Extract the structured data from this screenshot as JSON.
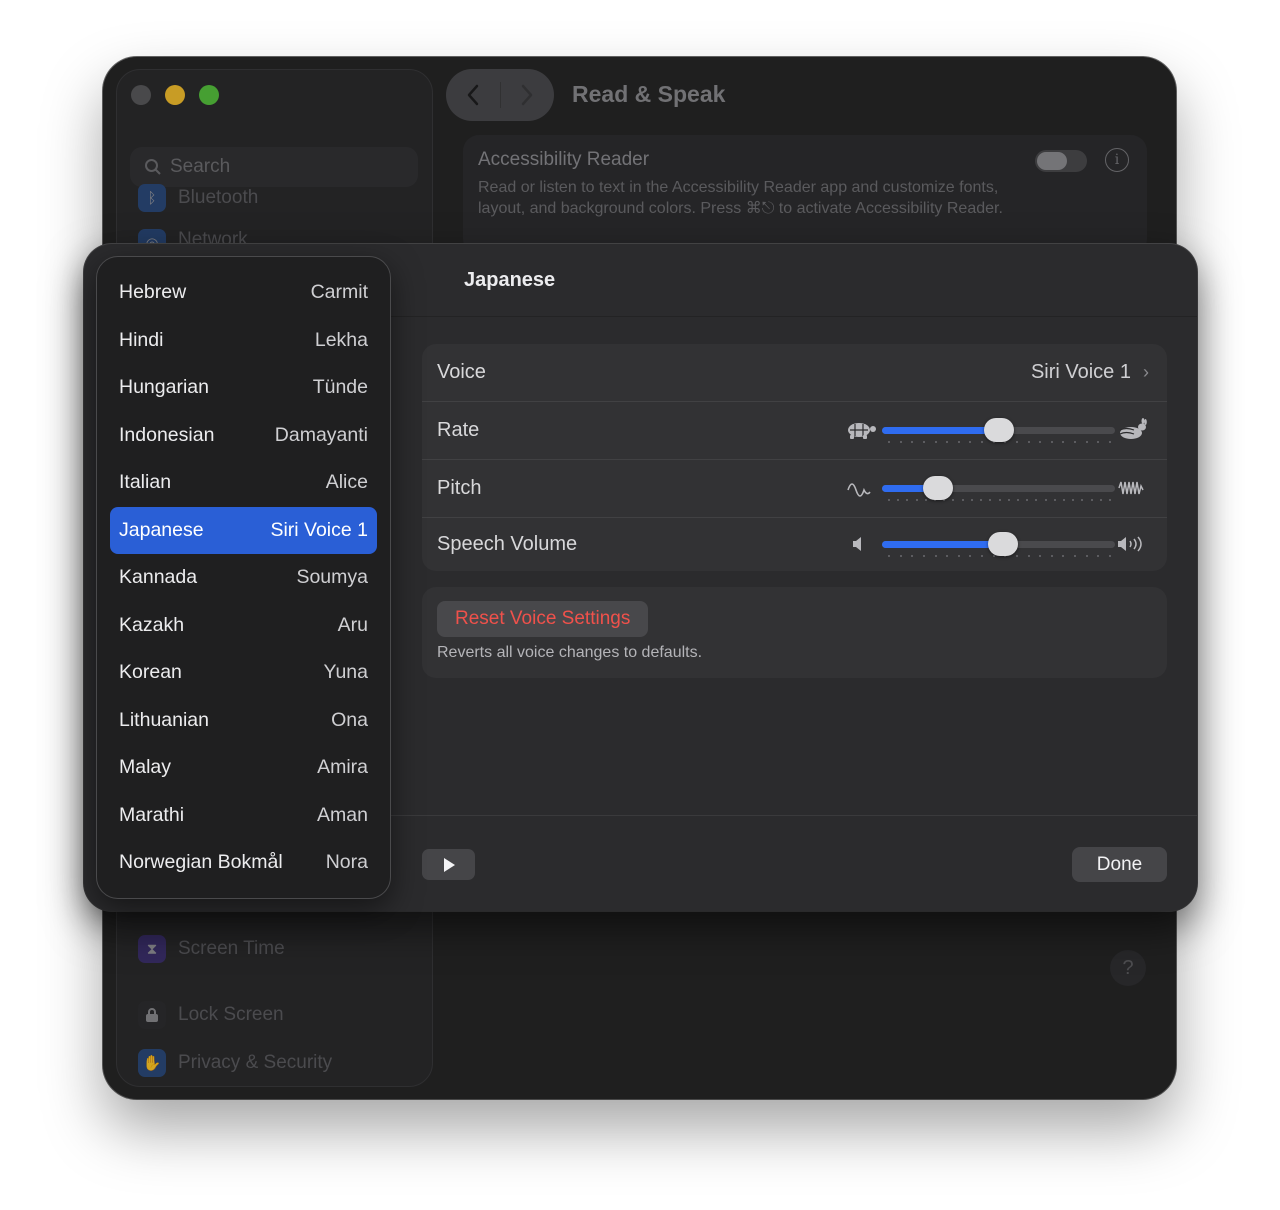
{
  "window": {
    "title": "Read & Speak",
    "search_placeholder": "Search",
    "sidebar_items": [
      {
        "label": "Bluetooth",
        "icon": "bluetooth-icon"
      },
      {
        "label": "Network",
        "icon": "network-icon"
      },
      {
        "label": "Screen Time",
        "icon": "hourglass-icon"
      },
      {
        "label": "Lock Screen",
        "icon": "lock-icon"
      },
      {
        "label": "Privacy & Security",
        "icon": "hand-icon"
      }
    ],
    "accessibility_reader": {
      "title": "Accessibility Reader",
      "description": "Read or listen to text in the Accessibility Reader app and customize fonts, layout, and background colors. Press ⌘⎋ to activate Accessibility Reader.",
      "enabled": false
    },
    "help_label": "?"
  },
  "sheet": {
    "title": "Japanese",
    "voice": {
      "label": "Voice",
      "value": "Siri Voice 1"
    },
    "rate": {
      "label": "Rate",
      "level": 0.5
    },
    "pitch": {
      "label": "Pitch",
      "level": 0.24
    },
    "speech_volume": {
      "label": "Speech Volume",
      "level": 0.52
    },
    "reset": {
      "button_label": "Reset Voice Settings",
      "description": "Reverts all voice changes to defaults."
    },
    "done_label": "Done"
  },
  "languages": [
    {
      "name": "Hebrew",
      "voice": "Carmit"
    },
    {
      "name": "Hindi",
      "voice": "Lekha"
    },
    {
      "name": "Hungarian",
      "voice": "Tünde"
    },
    {
      "name": "Indonesian",
      "voice": "Damayanti"
    },
    {
      "name": "Italian",
      "voice": "Alice"
    },
    {
      "name": "Japanese",
      "voice": "Siri Voice 1",
      "selected": true
    },
    {
      "name": "Kannada",
      "voice": "Soumya"
    },
    {
      "name": "Kazakh",
      "voice": "Aru"
    },
    {
      "name": "Korean",
      "voice": "Yuna"
    },
    {
      "name": "Lithuanian",
      "voice": "Ona"
    },
    {
      "name": "Malay",
      "voice": "Amira"
    },
    {
      "name": "Marathi",
      "voice": "Aman"
    },
    {
      "name": "Norwegian Bokmål",
      "voice": "Nora"
    }
  ],
  "colors": {
    "accent": "#2f6cf0",
    "selection": "#2a5fd6",
    "destructive": "#f0514b",
    "traffic_close": "#5a5a5c",
    "traffic_minimize": "#f5bf2e",
    "traffic_zoom": "#56c23e"
  }
}
